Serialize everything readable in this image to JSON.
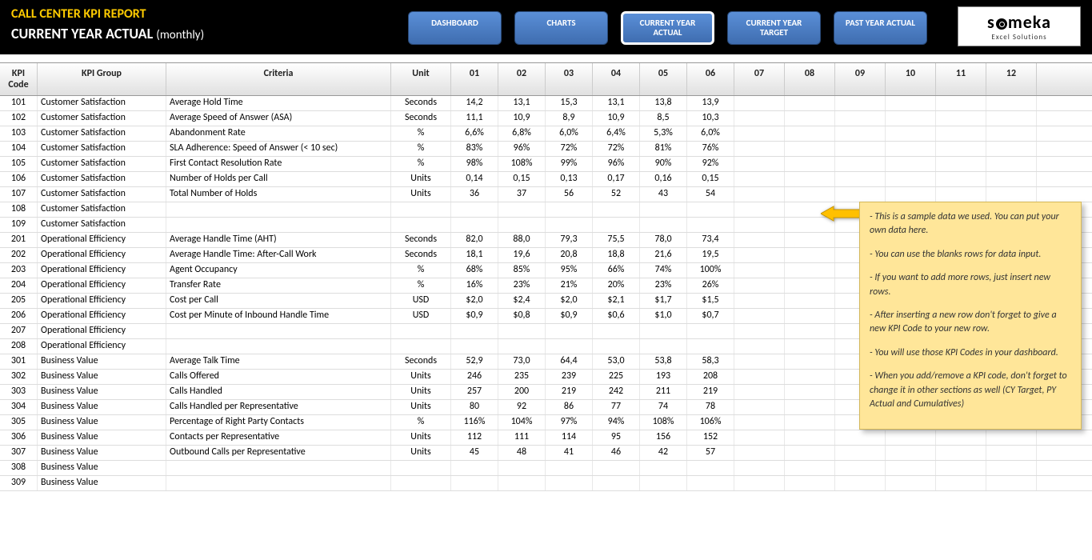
{
  "header": {
    "title": "CALL CENTER KPI REPORT",
    "subtitle": "CURRENT YEAR ACTUAL",
    "subtitle_suffix": "(monthly)"
  },
  "nav": [
    {
      "label": "DASHBOARD"
    },
    {
      "label": "CHARTS"
    },
    {
      "label": "CURRENT YEAR ACTUAL",
      "active": true
    },
    {
      "label": "CURRENT YEAR TARGET"
    },
    {
      "label": "PAST YEAR ACTUAL"
    }
  ],
  "logo": {
    "brand_pre": "s",
    "brand_post": "meka",
    "sub": "Excel Solutions"
  },
  "columns": {
    "code": "KPI Code",
    "group": "KPI Group",
    "criteria": "Criteria",
    "unit": "Unit",
    "months": [
      "01",
      "02",
      "03",
      "04",
      "05",
      "06",
      "07",
      "08",
      "09",
      "10",
      "11",
      "12"
    ]
  },
  "rows": [
    {
      "code": "101",
      "group": "Customer Satisfaction",
      "criteria": "Average Hold Time",
      "unit": "Seconds",
      "m": [
        "14,2",
        "13,1",
        "15,3",
        "13,1",
        "13,8",
        "13,9",
        "",
        "",
        "",
        "",
        "",
        ""
      ]
    },
    {
      "code": "102",
      "group": "Customer Satisfaction",
      "criteria": "Average Speed of Answer (ASA)",
      "unit": "Seconds",
      "m": [
        "11,1",
        "10,9",
        "8,9",
        "10,9",
        "8,5",
        "10,3",
        "",
        "",
        "",
        "",
        "",
        ""
      ]
    },
    {
      "code": "103",
      "group": "Customer Satisfaction",
      "criteria": "Abandonment Rate",
      "unit": "%",
      "m": [
        "6,6%",
        "6,8%",
        "6,0%",
        "6,4%",
        "5,3%",
        "6,0%",
        "",
        "",
        "",
        "",
        "",
        ""
      ]
    },
    {
      "code": "104",
      "group": "Customer Satisfaction",
      "criteria": "SLA Adherence: Speed of Answer (< 10 sec)",
      "unit": "%",
      "m": [
        "83%",
        "96%",
        "72%",
        "72%",
        "81%",
        "76%",
        "",
        "",
        "",
        "",
        "",
        ""
      ]
    },
    {
      "code": "105",
      "group": "Customer Satisfaction",
      "criteria": "First Contact Resolution Rate",
      "unit": "%",
      "m": [
        "98%",
        "108%",
        "99%",
        "96%",
        "90%",
        "92%",
        "",
        "",
        "",
        "",
        "",
        ""
      ]
    },
    {
      "code": "106",
      "group": "Customer Satisfaction",
      "criteria": "Number of Holds per Call",
      "unit": "Units",
      "m": [
        "0,14",
        "0,15",
        "0,13",
        "0,17",
        "0,16",
        "0,15",
        "",
        "",
        "",
        "",
        "",
        ""
      ]
    },
    {
      "code": "107",
      "group": "Customer Satisfaction",
      "criteria": "Total Number of Holds",
      "unit": "Units",
      "m": [
        "36",
        "37",
        "56",
        "52",
        "43",
        "54",
        "",
        "",
        "",
        "",
        "",
        ""
      ]
    },
    {
      "code": "108",
      "group": "Customer Satisfaction",
      "criteria": "",
      "unit": "",
      "m": [
        "",
        "",
        "",
        "",
        "",
        "",
        "",
        "",
        "",
        "",
        "",
        ""
      ]
    },
    {
      "code": "109",
      "group": "Customer Satisfaction",
      "criteria": "",
      "unit": "",
      "m": [
        "",
        "",
        "",
        "",
        "",
        "",
        "",
        "",
        "",
        "",
        "",
        ""
      ]
    },
    {
      "code": "201",
      "group": "Operational Efficiency",
      "criteria": "Average Handle Time (AHT)",
      "unit": "Seconds",
      "m": [
        "82,0",
        "88,0",
        "79,3",
        "75,5",
        "78,0",
        "73,4",
        "",
        "",
        "",
        "",
        "",
        ""
      ]
    },
    {
      "code": "202",
      "group": "Operational Efficiency",
      "criteria": "Average Handle Time: After-Call Work",
      "unit": "Seconds",
      "m": [
        "18,1",
        "19,6",
        "20,8",
        "18,8",
        "21,6",
        "19,5",
        "",
        "",
        "",
        "",
        "",
        ""
      ]
    },
    {
      "code": "203",
      "group": "Operational Efficiency",
      "criteria": "Agent Occupancy",
      "unit": "%",
      "m": [
        "68%",
        "85%",
        "95%",
        "66%",
        "74%",
        "100%",
        "",
        "",
        "",
        "",
        "",
        ""
      ]
    },
    {
      "code": "204",
      "group": "Operational Efficiency",
      "criteria": "Transfer Rate",
      "unit": "%",
      "m": [
        "16%",
        "23%",
        "21%",
        "20%",
        "23%",
        "26%",
        "",
        "",
        "",
        "",
        "",
        ""
      ]
    },
    {
      "code": "205",
      "group": "Operational Efficiency",
      "criteria": "Cost per Call",
      "unit": "USD",
      "m": [
        "$2,0",
        "$2,4",
        "$2,0",
        "$2,1",
        "$1,7",
        "$1,5",
        "",
        "",
        "",
        "",
        "",
        ""
      ]
    },
    {
      "code": "206",
      "group": "Operational Efficiency",
      "criteria": "Cost per Minute of Inbound Handle Time",
      "unit": "USD",
      "m": [
        "$0,9",
        "$0,8",
        "$0,9",
        "$0,6",
        "$1,0",
        "$0,7",
        "",
        "",
        "",
        "",
        "",
        ""
      ]
    },
    {
      "code": "207",
      "group": "Operational Efficiency",
      "criteria": "",
      "unit": "",
      "m": [
        "",
        "",
        "",
        "",
        "",
        "",
        "",
        "",
        "",
        "",
        "",
        ""
      ]
    },
    {
      "code": "208",
      "group": "Operational Efficiency",
      "criteria": "",
      "unit": "",
      "m": [
        "",
        "",
        "",
        "",
        "",
        "",
        "",
        "",
        "",
        "",
        "",
        ""
      ]
    },
    {
      "code": "301",
      "group": "Business Value",
      "criteria": "Average Talk Time",
      "unit": "Seconds",
      "m": [
        "52,9",
        "73,0",
        "64,4",
        "53,0",
        "53,8",
        "58,3",
        "",
        "",
        "",
        "",
        "",
        ""
      ]
    },
    {
      "code": "302",
      "group": "Business Value",
      "criteria": "Calls Offered",
      "unit": "Units",
      "m": [
        "246",
        "235",
        "239",
        "225",
        "193",
        "208",
        "",
        "",
        "",
        "",
        "",
        ""
      ]
    },
    {
      "code": "303",
      "group": "Business Value",
      "criteria": "Calls Handled",
      "unit": "Units",
      "m": [
        "257",
        "200",
        "219",
        "242",
        "211",
        "219",
        "",
        "",
        "",
        "",
        "",
        ""
      ]
    },
    {
      "code": "304",
      "group": "Business Value",
      "criteria": "Calls Handled per Representative",
      "unit": "Units",
      "m": [
        "80",
        "92",
        "86",
        "77",
        "74",
        "78",
        "",
        "",
        "",
        "",
        "",
        ""
      ]
    },
    {
      "code": "305",
      "group": "Business Value",
      "criteria": "Percentage of Right Party Contacts",
      "unit": "%",
      "m": [
        "116%",
        "104%",
        "97%",
        "94%",
        "108%",
        "106%",
        "",
        "",
        "",
        "",
        "",
        ""
      ]
    },
    {
      "code": "306",
      "group": "Business Value",
      "criteria": "Contacts per Representative",
      "unit": "Units",
      "m": [
        "112",
        "111",
        "114",
        "95",
        "156",
        "152",
        "",
        "",
        "",
        "",
        "",
        ""
      ]
    },
    {
      "code": "307",
      "group": "Business Value",
      "criteria": "Outbound Calls per Representative",
      "unit": "Units",
      "m": [
        "45",
        "48",
        "41",
        "46",
        "42",
        "57",
        "",
        "",
        "",
        "",
        "",
        ""
      ]
    },
    {
      "code": "308",
      "group": "Business Value",
      "criteria": "",
      "unit": "",
      "m": [
        "",
        "",
        "",
        "",
        "",
        "",
        "",
        "",
        "",
        "",
        "",
        ""
      ]
    },
    {
      "code": "309",
      "group": "Business Value",
      "criteria": "",
      "unit": "",
      "m": [
        "",
        "",
        "",
        "",
        "",
        "",
        "",
        "",
        "",
        "",
        "",
        ""
      ]
    }
  ],
  "note": [
    "- This is a sample data we used. You can put your own data here.",
    "- You can use the blanks rows for data input.",
    "- If you want to add more rows, just insert new rows.",
    "- After inserting a new row don't forget to give a new KPI Code to your new row.",
    "- You will use those KPI Codes in your dashboard.",
    "- When you add/remove a KPI code, don't forget to change it in other sections as well (CY Target, PY Actual and Cumulatives)"
  ]
}
